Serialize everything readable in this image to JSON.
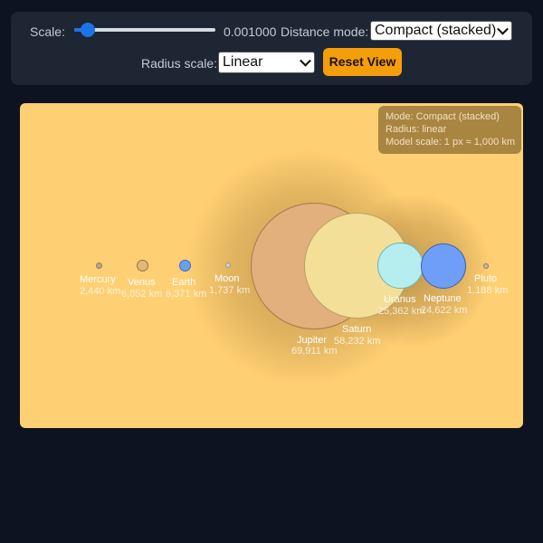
{
  "controls": {
    "scale_label": "Scale:",
    "scale_value": "0.001000",
    "distance_mode_label": "Distance mode:",
    "distance_mode_selected": "Compact (stacked)",
    "radius_scale_label": "Radius scale:",
    "radius_scale_selected": "Linear",
    "reset_label": "Reset View",
    "slider_level_fraction": 0.05,
    "accent_color": "#1a73e8",
    "button_color": "#f59e0b"
  },
  "info": {
    "mode": "Mode: Compact (stacked)",
    "radius": "Radius: linear",
    "model_scale": "Model scale: 1 px ≈ 1,000 km"
  },
  "canvas": {
    "background": "#ffd073"
  },
  "bodies": [
    {
      "name": "Mercury",
      "diameter": "2,440 km",
      "color": "#b9a98f"
    },
    {
      "name": "Venus",
      "diameter": "6,052 km",
      "color": "#e3b97a"
    },
    {
      "name": "Earth",
      "diameter": "6,371 km",
      "color": "#6aa0f0"
    },
    {
      "name": "Moon",
      "diameter": "1,737 km",
      "color": "#cfcfcf"
    },
    {
      "name": "Jupiter",
      "diameter": "69,911 km",
      "color": "#e2b07c"
    },
    {
      "name": "Saturn",
      "diameter": "58,232 km",
      "color": "#f4df98"
    },
    {
      "name": "Uranus",
      "diameter": "25,362 km",
      "color": "#b6eef0"
    },
    {
      "name": "Neptune",
      "diameter": "24,622 km",
      "color": "#6f9ef8"
    },
    {
      "name": "Pluto",
      "diameter": "1,188 km",
      "color": "#c7b9a6"
    }
  ]
}
